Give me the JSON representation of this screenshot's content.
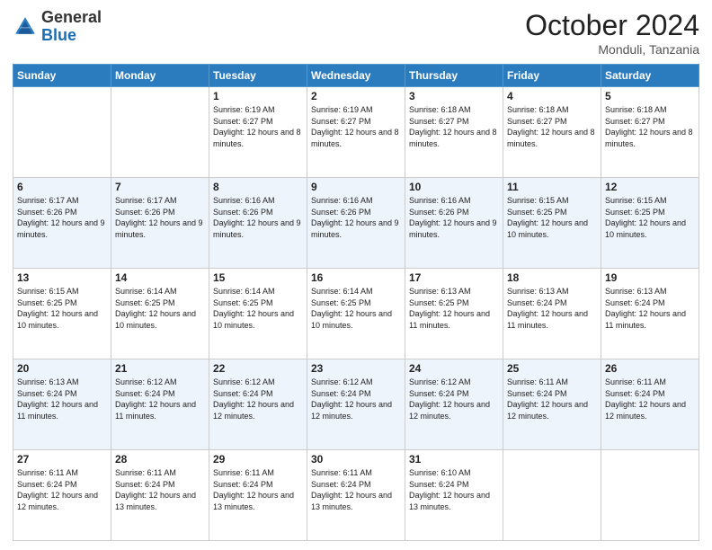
{
  "logo": {
    "general": "General",
    "blue": "Blue"
  },
  "header": {
    "month_year": "October 2024",
    "location": "Monduli, Tanzania"
  },
  "days_of_week": [
    "Sunday",
    "Monday",
    "Tuesday",
    "Wednesday",
    "Thursday",
    "Friday",
    "Saturday"
  ],
  "weeks": [
    [
      {
        "day": "",
        "info": ""
      },
      {
        "day": "",
        "info": ""
      },
      {
        "day": "1",
        "info": "Sunrise: 6:19 AM\nSunset: 6:27 PM\nDaylight: 12 hours and 8 minutes."
      },
      {
        "day": "2",
        "info": "Sunrise: 6:19 AM\nSunset: 6:27 PM\nDaylight: 12 hours and 8 minutes."
      },
      {
        "day": "3",
        "info": "Sunrise: 6:18 AM\nSunset: 6:27 PM\nDaylight: 12 hours and 8 minutes."
      },
      {
        "day": "4",
        "info": "Sunrise: 6:18 AM\nSunset: 6:27 PM\nDaylight: 12 hours and 8 minutes."
      },
      {
        "day": "5",
        "info": "Sunrise: 6:18 AM\nSunset: 6:27 PM\nDaylight: 12 hours and 8 minutes."
      }
    ],
    [
      {
        "day": "6",
        "info": "Sunrise: 6:17 AM\nSunset: 6:26 PM\nDaylight: 12 hours and 9 minutes."
      },
      {
        "day": "7",
        "info": "Sunrise: 6:17 AM\nSunset: 6:26 PM\nDaylight: 12 hours and 9 minutes."
      },
      {
        "day": "8",
        "info": "Sunrise: 6:16 AM\nSunset: 6:26 PM\nDaylight: 12 hours and 9 minutes."
      },
      {
        "day": "9",
        "info": "Sunrise: 6:16 AM\nSunset: 6:26 PM\nDaylight: 12 hours and 9 minutes."
      },
      {
        "day": "10",
        "info": "Sunrise: 6:16 AM\nSunset: 6:26 PM\nDaylight: 12 hours and 9 minutes."
      },
      {
        "day": "11",
        "info": "Sunrise: 6:15 AM\nSunset: 6:25 PM\nDaylight: 12 hours and 10 minutes."
      },
      {
        "day": "12",
        "info": "Sunrise: 6:15 AM\nSunset: 6:25 PM\nDaylight: 12 hours and 10 minutes."
      }
    ],
    [
      {
        "day": "13",
        "info": "Sunrise: 6:15 AM\nSunset: 6:25 PM\nDaylight: 12 hours and 10 minutes."
      },
      {
        "day": "14",
        "info": "Sunrise: 6:14 AM\nSunset: 6:25 PM\nDaylight: 12 hours and 10 minutes."
      },
      {
        "day": "15",
        "info": "Sunrise: 6:14 AM\nSunset: 6:25 PM\nDaylight: 12 hours and 10 minutes."
      },
      {
        "day": "16",
        "info": "Sunrise: 6:14 AM\nSunset: 6:25 PM\nDaylight: 12 hours and 10 minutes."
      },
      {
        "day": "17",
        "info": "Sunrise: 6:13 AM\nSunset: 6:25 PM\nDaylight: 12 hours and 11 minutes."
      },
      {
        "day": "18",
        "info": "Sunrise: 6:13 AM\nSunset: 6:24 PM\nDaylight: 12 hours and 11 minutes."
      },
      {
        "day": "19",
        "info": "Sunrise: 6:13 AM\nSunset: 6:24 PM\nDaylight: 12 hours and 11 minutes."
      }
    ],
    [
      {
        "day": "20",
        "info": "Sunrise: 6:13 AM\nSunset: 6:24 PM\nDaylight: 12 hours and 11 minutes."
      },
      {
        "day": "21",
        "info": "Sunrise: 6:12 AM\nSunset: 6:24 PM\nDaylight: 12 hours and 11 minutes."
      },
      {
        "day": "22",
        "info": "Sunrise: 6:12 AM\nSunset: 6:24 PM\nDaylight: 12 hours and 12 minutes."
      },
      {
        "day": "23",
        "info": "Sunrise: 6:12 AM\nSunset: 6:24 PM\nDaylight: 12 hours and 12 minutes."
      },
      {
        "day": "24",
        "info": "Sunrise: 6:12 AM\nSunset: 6:24 PM\nDaylight: 12 hours and 12 minutes."
      },
      {
        "day": "25",
        "info": "Sunrise: 6:11 AM\nSunset: 6:24 PM\nDaylight: 12 hours and 12 minutes."
      },
      {
        "day": "26",
        "info": "Sunrise: 6:11 AM\nSunset: 6:24 PM\nDaylight: 12 hours and 12 minutes."
      }
    ],
    [
      {
        "day": "27",
        "info": "Sunrise: 6:11 AM\nSunset: 6:24 PM\nDaylight: 12 hours and 12 minutes."
      },
      {
        "day": "28",
        "info": "Sunrise: 6:11 AM\nSunset: 6:24 PM\nDaylight: 12 hours and 13 minutes."
      },
      {
        "day": "29",
        "info": "Sunrise: 6:11 AM\nSunset: 6:24 PM\nDaylight: 12 hours and 13 minutes."
      },
      {
        "day": "30",
        "info": "Sunrise: 6:11 AM\nSunset: 6:24 PM\nDaylight: 12 hours and 13 minutes."
      },
      {
        "day": "31",
        "info": "Sunrise: 6:10 AM\nSunset: 6:24 PM\nDaylight: 12 hours and 13 minutes."
      },
      {
        "day": "",
        "info": ""
      },
      {
        "day": "",
        "info": ""
      }
    ]
  ]
}
